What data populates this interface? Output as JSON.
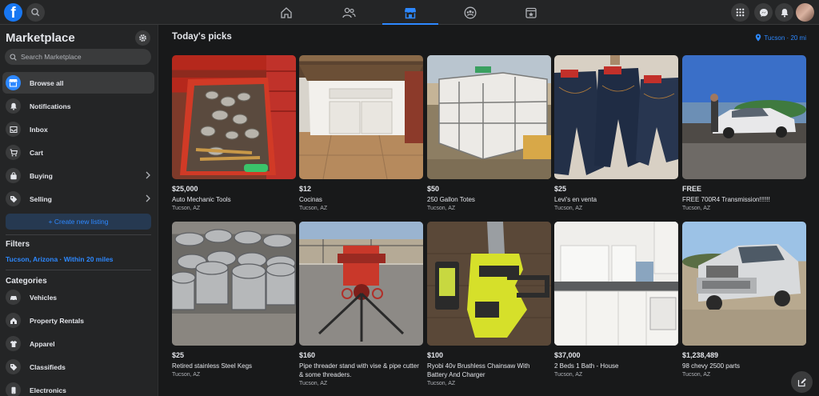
{
  "topbar": {
    "logo": "f",
    "nav_tabs": [
      {
        "icon": "home-icon",
        "active": false
      },
      {
        "icon": "friends-icon",
        "active": false
      },
      {
        "icon": "marketplace-icon",
        "active": true
      },
      {
        "icon": "groups-icon",
        "active": false
      },
      {
        "icon": "gaming-icon",
        "active": false
      }
    ],
    "right_icons": [
      "menu-grid-icon",
      "messenger-icon",
      "notifications-icon",
      "account-avatar"
    ]
  },
  "sidebar": {
    "title": "Marketplace",
    "search_placeholder": "Search Marketplace",
    "items": [
      {
        "label": "Browse all",
        "icon": "storefront-icon",
        "active": true,
        "chevron": false
      },
      {
        "label": "Notifications",
        "icon": "bell-icon",
        "active": false,
        "chevron": false
      },
      {
        "label": "Inbox",
        "icon": "inbox-icon",
        "active": false,
        "chevron": false
      },
      {
        "label": "Cart",
        "icon": "cart-icon",
        "active": false,
        "chevron": false
      },
      {
        "label": "Buying",
        "icon": "bag-icon",
        "active": false,
        "chevron": true
      },
      {
        "label": "Selling",
        "icon": "tag-icon",
        "active": false,
        "chevron": true
      }
    ],
    "create_listing": "+ Create new listing",
    "filters_title": "Filters",
    "filter_value": "Tucson, Arizona · Within 20 miles",
    "categories_title": "Categories",
    "categories": [
      {
        "label": "Vehicles",
        "icon": "car-icon"
      },
      {
        "label": "Property Rentals",
        "icon": "house-icon"
      },
      {
        "label": "Apparel",
        "icon": "shirt-icon"
      },
      {
        "label": "Classifieds",
        "icon": "tag-icon"
      },
      {
        "label": "Electronics",
        "icon": "phone-icon"
      }
    ]
  },
  "main": {
    "title": "Today's picks",
    "location": "Tucson · 20 mi",
    "listings": [
      {
        "price": "$25,000",
        "title": "Auto Mechanic Tools",
        "location": "Tucson, AZ",
        "image": "tools"
      },
      {
        "price": "$12",
        "title": "Cocinas",
        "location": "Tucson, AZ",
        "image": "cabinet"
      },
      {
        "price": "$50",
        "title": "250 Gallon Totes",
        "location": "Tucson, AZ",
        "image": "totes"
      },
      {
        "price": "$25",
        "title": "Levi's en venta",
        "location": "Tucson, AZ",
        "image": "jeans"
      },
      {
        "price": "FREE",
        "title": "FREE 700R4 Transmission!!!!!!",
        "location": "Tucson, AZ",
        "image": "car"
      },
      {
        "price": "$25",
        "title": "Retired stainless Steel Kegs",
        "location": "Tucson, AZ",
        "image": "kegs"
      },
      {
        "price": "$160",
        "title": "Pipe threader stand with vise & pipe cutter & some threaders.",
        "location": "Tucson, AZ",
        "image": "pipe"
      },
      {
        "price": "$100",
        "title": "Ryobi 40v Brushless Chainsaw With Battery And Charger",
        "location": "Tucson, AZ",
        "image": "saw"
      },
      {
        "price": "$37,000",
        "title": "2 Beds 1 Bath - House",
        "location": "Tucson, AZ",
        "image": "house"
      },
      {
        "price": "$1,238,489",
        "title": "98 chevy 2500 parts",
        "location": "Tucson, AZ",
        "image": "truck"
      }
    ]
  },
  "colors": {
    "background": "#18191a",
    "surface": "#242526",
    "accent": "#2d88ff",
    "text": "#e4e6eb",
    "muted": "#b0b3b8"
  }
}
